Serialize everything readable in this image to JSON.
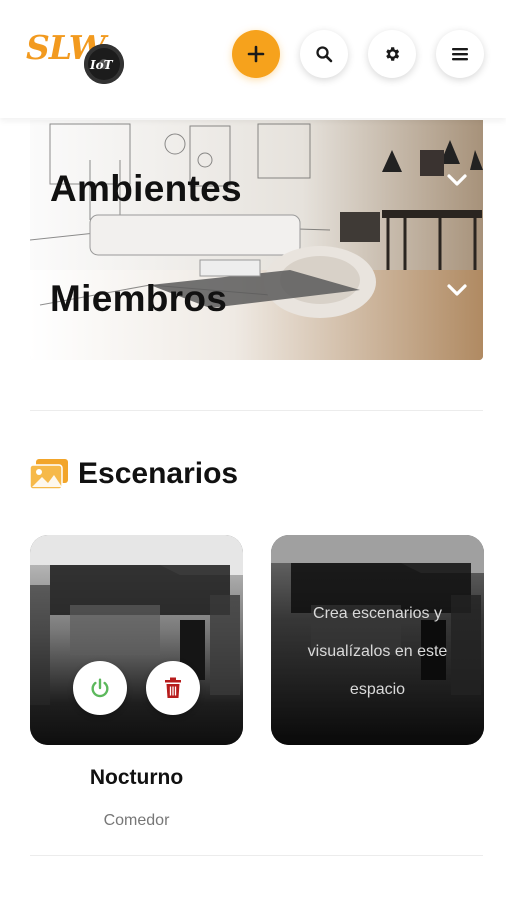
{
  "header": {
    "logo_text": "SLW",
    "logo_sub": "IoT",
    "add_label": "+",
    "buttons": {
      "add": "plus-icon",
      "search": "search-icon",
      "settings": "gear-icon",
      "menu": "hamburger-icon"
    },
    "accent_color": "#f6a21c"
  },
  "hero": {
    "sections": [
      {
        "label": "Ambientes",
        "icon": "chevron-down-icon"
      },
      {
        "label": "Miembros",
        "icon": "chevron-down-icon"
      }
    ]
  },
  "scenes": {
    "title": "Escenarios",
    "icon": "images-icon",
    "icon_color": "#f2a52a",
    "cards": [
      {
        "name": "Nocturno",
        "room": "Comedor",
        "actions": [
          "power-icon",
          "trash-icon"
        ],
        "power_color": "#5cb85c",
        "trash_color": "#b71c1c"
      }
    ],
    "empty_message": "Crea escenarios y visualízalos en este espacio"
  }
}
